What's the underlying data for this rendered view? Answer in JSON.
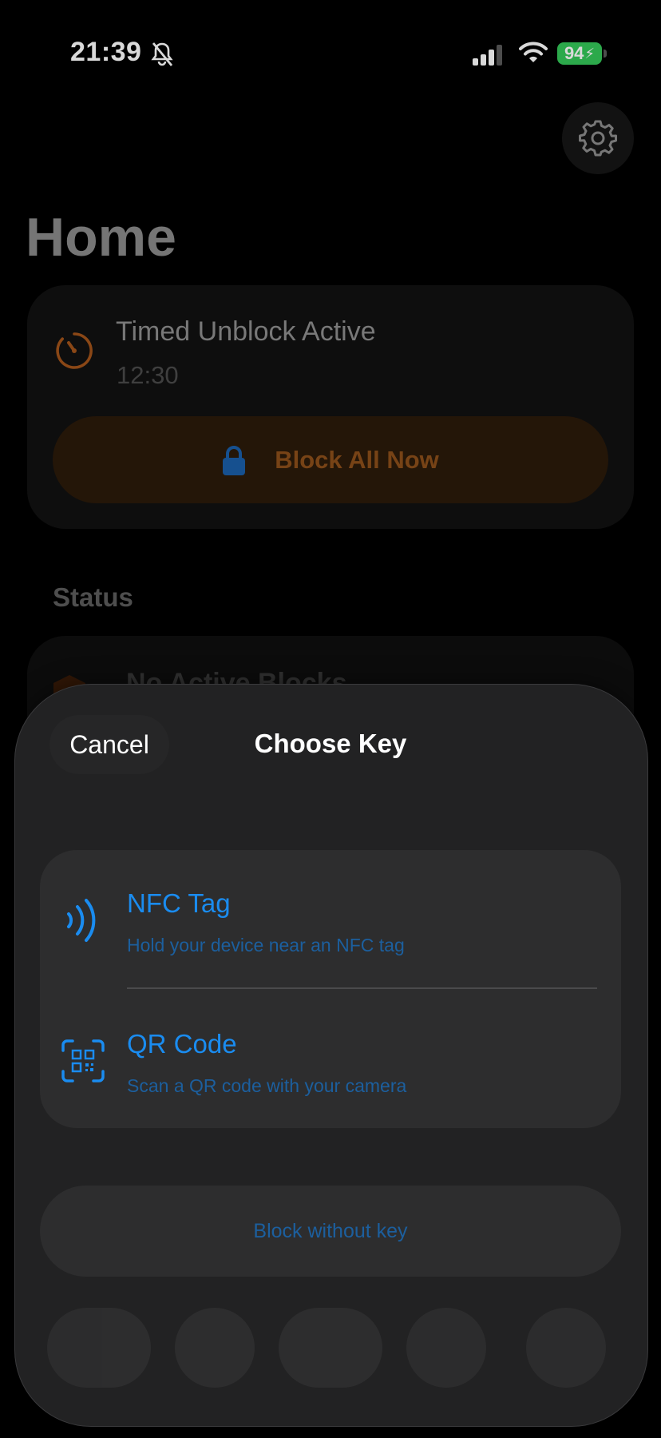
{
  "status_bar": {
    "time": "21:39",
    "battery": "94",
    "icons": [
      "bell-slash-icon",
      "cellular-signal-icon",
      "wifi-icon",
      "battery-charging-icon"
    ]
  },
  "header": {
    "title": "Home",
    "settings_icon": "gear-icon"
  },
  "timed_card": {
    "title": "Timed Unblock Active",
    "time": "12:30",
    "icon": "timer-icon",
    "button_label": "Block All Now",
    "button_icon": "lock-icon"
  },
  "status": {
    "section_title": "Status",
    "card_label": "No Active Blocks"
  },
  "sheet": {
    "cancel_label": "Cancel",
    "title": "Choose Key",
    "options": [
      {
        "title": "NFC Tag",
        "subtitle": "Hold your device near an NFC tag",
        "icon": "nfc-waves-icon"
      },
      {
        "title": "QR Code",
        "subtitle": "Scan a QR code with your camera",
        "icon": "qr-code-scan-icon"
      }
    ],
    "no_key_label": "Block without key"
  },
  "colors": {
    "accent_blue": "#1a8cf0",
    "accent_orange": "#c2621f",
    "battery_green": "#34c759"
  }
}
